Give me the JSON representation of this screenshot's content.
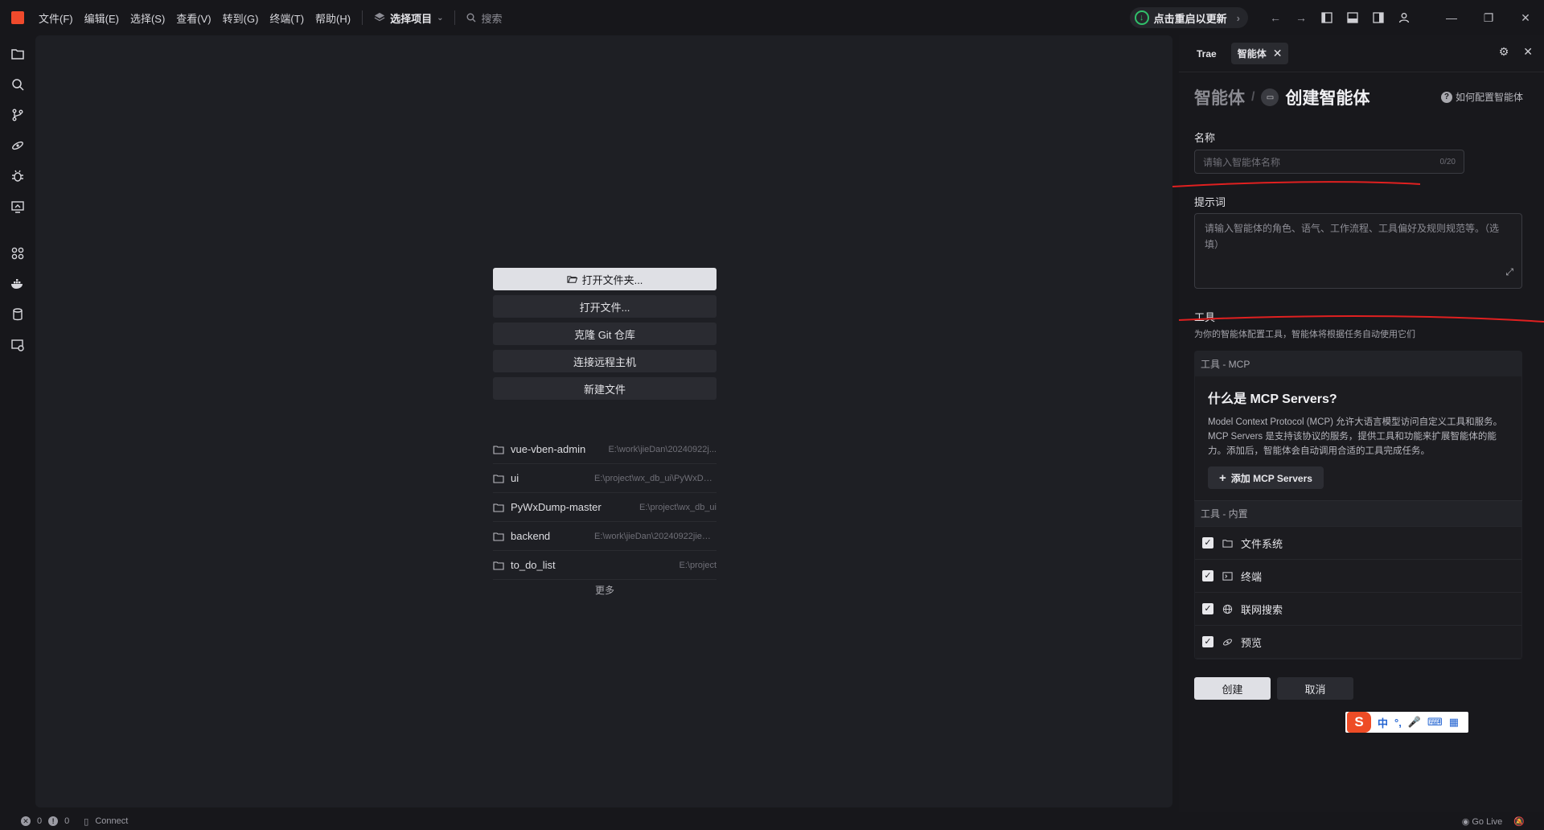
{
  "menu": [
    "文件(F)",
    "编辑(E)",
    "选择(S)",
    "查看(V)",
    "转到(G)",
    "终端(T)",
    "帮助(H)"
  ],
  "project_select": "选择项目",
  "search_placeholder": "搜索",
  "update_label": "点击重启以更新",
  "welcome": {
    "actions": [
      "打开文件夹...",
      "打开文件...",
      "克隆 Git 仓库",
      "连接远程主机",
      "新建文件"
    ],
    "recent": [
      {
        "name": "vue-vben-admin",
        "path": "E:\\work\\jieDan\\20240922j..."
      },
      {
        "name": "ui",
        "path": "E:\\project\\wx_db_ui\\PyWxDump-master..."
      },
      {
        "name": "PyWxDump-master",
        "path": "E:\\project\\wx_db_ui"
      },
      {
        "name": "backend",
        "path": "E:\\work\\jieDan\\20240922jieDan1_..."
      },
      {
        "name": "to_do_list",
        "path": "E:\\project"
      }
    ],
    "more": "更多"
  },
  "panel": {
    "tabs": [
      "Trae",
      "智能体"
    ],
    "breadcrumb_parent": "智能体",
    "breadcrumb_current": "创建智能体",
    "help_link": "如何配置智能体",
    "name_label": "名称",
    "name_placeholder": "请输入智能体名称",
    "name_count": "0/20",
    "prompt_label": "提示词",
    "prompt_placeholder": "请输入智能体的角色、语气、工作流程、工具偏好及规则规范等。（选填）",
    "tools_label": "工具",
    "tools_desc": "为你的智能体配置工具，智能体将根据任务自动使用它们",
    "mcp_header": "工具 - MCP",
    "mcp_title": "什么是 MCP Servers?",
    "mcp_desc": "Model Context Protocol (MCP) 允许大语言模型访问自定义工具和服务。MCP Servers 是支持该协议的服务，提供工具和功能来扩展智能体的能力。添加后，智能体会自动调用合适的工具完成任务。",
    "add_mcp": "添加 MCP Servers",
    "builtin_header": "工具 - 内置",
    "builtin_tools": [
      "文件系统",
      "终端",
      "联网搜索",
      "预览"
    ],
    "create": "创建",
    "cancel": "取消"
  },
  "ime": {
    "lang": "中",
    "punct": "°,"
  },
  "status": {
    "errors": "0",
    "warnings": "0",
    "connect": "Connect",
    "golive": "Go Live"
  },
  "colors": {
    "accent_red": "#e02020",
    "update_green": "#30c06a",
    "ime_orange": "#ee4c26"
  }
}
